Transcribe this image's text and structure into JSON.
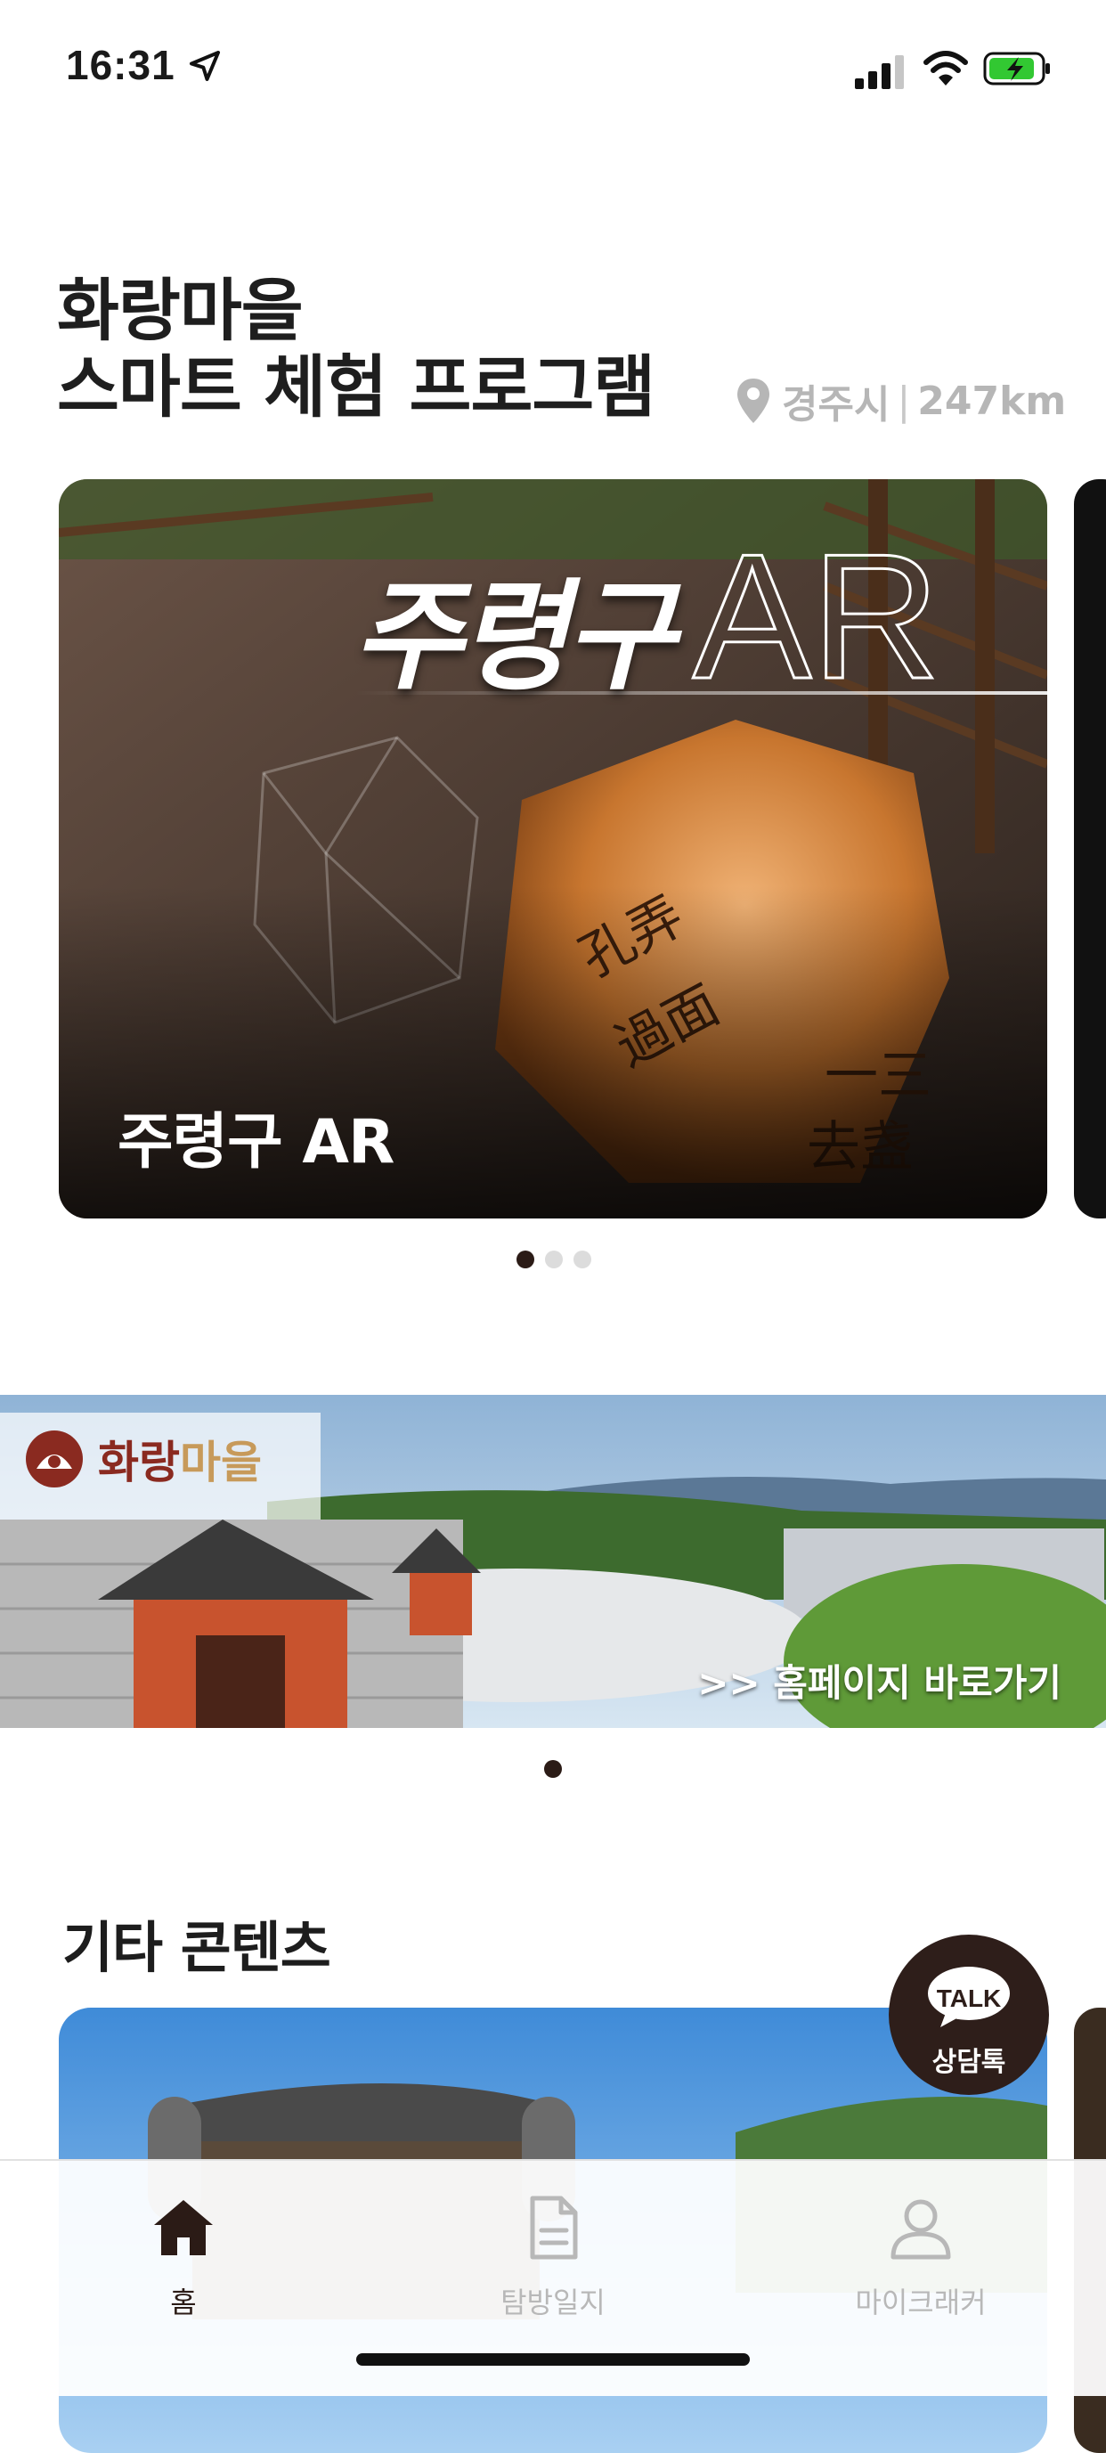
{
  "status_bar": {
    "time": "16:31"
  },
  "header": {
    "title_line1": "화랑마을",
    "title_line2": "스마트 체험 프로그램",
    "location_city": "경주시",
    "location_distance": "247km"
  },
  "carousel": {
    "card_hero_ko": "주령구",
    "card_hero_en": "AR",
    "card_label": "주령구 AR",
    "page_count": 3,
    "active_index": 0
  },
  "banner": {
    "logo_text_1": "화랑",
    "logo_text_2": "마을",
    "link_text": ">> 홈페이지 바로가기",
    "page_count": 1,
    "active_index": 0
  },
  "section": {
    "title": "기타 콘텐츠"
  },
  "talk_button": {
    "bubble": "TALK",
    "label": "상담톡"
  },
  "tabbar": {
    "items": [
      {
        "label": "홈",
        "icon": "home-icon",
        "active": true
      },
      {
        "label": "탐방일지",
        "icon": "document-icon",
        "active": false
      },
      {
        "label": "마이크래커",
        "icon": "user-icon",
        "active": false
      }
    ]
  },
  "colors": {
    "primary_dark": "#2b1b16",
    "inactive": "#b8b8b8",
    "accent_battery": "#32c832"
  }
}
